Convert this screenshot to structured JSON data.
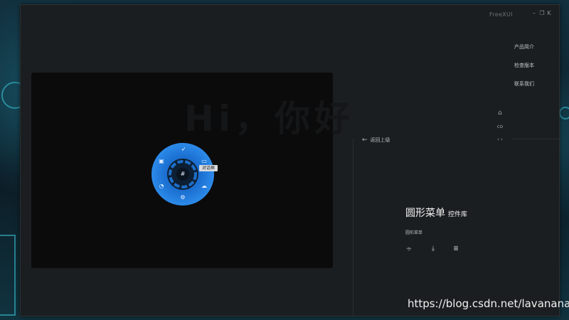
{
  "app": {
    "title": "FreeXUI"
  },
  "window_controls": {
    "minimize_icon": "minus-icon",
    "restore_icon": "restore-icon",
    "close_icon": "close-icon"
  },
  "top_menu": {
    "items": [
      {
        "label": "产品简介"
      },
      {
        "label": "检查版本"
      },
      {
        "label": "联系我们"
      }
    ]
  },
  "side_icons": [
    "home-icon",
    "link-icon",
    "arrows-icon"
  ],
  "stage": {
    "greeting": "Hi，你好"
  },
  "radial_menu": {
    "accent": "#1e7bd8",
    "tooltip": "对话框",
    "center_icon": "grid-icon",
    "items": [
      {
        "icon": "send-icon"
      },
      {
        "icon": "card-icon"
      },
      {
        "icon": "cloud-icon"
      },
      {
        "icon": "settings-icon"
      },
      {
        "icon": "pie-icon"
      },
      {
        "icon": "camera-icon"
      }
    ]
  },
  "panel": {
    "back_label": "返回上级",
    "title": "圆形菜单",
    "subtitle": "控件库",
    "caption": "圆形菜单",
    "tools": [
      "open-folder-icon",
      "download-icon",
      "list-icon"
    ]
  },
  "watermark": "https://blog.csdn.net/lavanana"
}
